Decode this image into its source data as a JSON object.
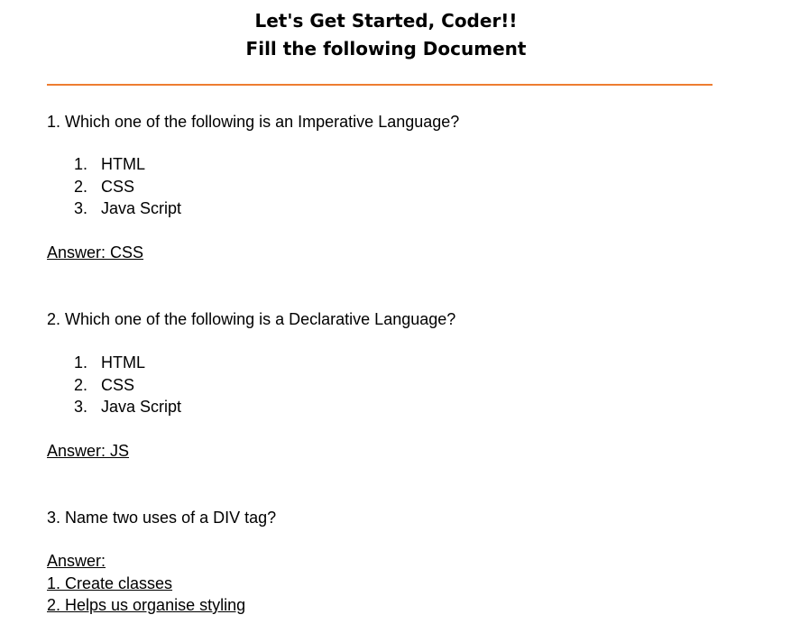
{
  "header": {
    "title_line1": "Let's Get Started, Coder!!",
    "title_line2": "Fill the following Document",
    "rule_color": "#ed7d31"
  },
  "questions": [
    {
      "text": "1. Which one of the following is an Imperative Language?",
      "options": [
        {
          "num": "1.",
          "label": "HTML"
        },
        {
          "num": "2.",
          "label": "CSS"
        },
        {
          "num": "3.",
          "label": "Java Script"
        }
      ],
      "answer": "Answer: CSS"
    },
    {
      "text": "2. Which one of the following is a Declarative Language?",
      "options": [
        {
          "num": "1.",
          "label": "HTML"
        },
        {
          "num": "2.",
          "label": "CSS"
        },
        {
          "num": "3.",
          "label": "Java Script"
        }
      ],
      "answer": "Answer: JS"
    },
    {
      "text": "3. Name two uses of a DIV tag?",
      "answer": "Answer:",
      "answer_lines": [
        "1. Create classes",
        "2. Helps us organise styling"
      ]
    }
  ]
}
